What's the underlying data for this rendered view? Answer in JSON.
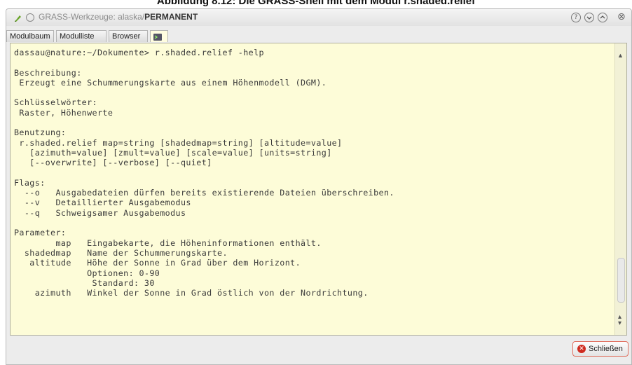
{
  "caption": {
    "text": "Abbildung 8.12: Die GRASS-Shell mit dem Modul r.shaded.relief"
  },
  "window": {
    "title_prefix": "GRASS-Werkzeuge: alaska/",
    "title_location": "PERMANENT",
    "controls": {
      "help_icon": "question-icon",
      "minimize_icon": "chevron-down-icon",
      "maximize_icon": "chevron-up-icon",
      "close_glyph": "⊗"
    }
  },
  "tabs": [
    {
      "label": "Modulbaum"
    },
    {
      "label": "Modulliste"
    },
    {
      "label": "Browser"
    },
    {
      "label": "",
      "icon": "shell-icon"
    }
  ],
  "console": {
    "lines": [
      "dassau@nature:~/Dokumente> r.shaded.relief -help",
      "",
      "Beschreibung:",
      " Erzeugt eine Schummerungskarte aus einem Höhenmodell (DGM).",
      "",
      "Schlüsselwörter:",
      " Raster, Höhenwerte",
      "",
      "Benutzung:",
      " r.shaded.relief map=string [shadedmap=string] [altitude=value]",
      "   [azimuth=value] [zmult=value] [scale=value] [units=string]",
      "   [--overwrite] [--verbose] [--quiet]",
      "",
      "Flags:",
      "  --o   Ausgabedateien dürfen bereits existierende Dateien überschreiben.",
      "  --v   Detaillierter Ausgabemodus",
      "  --q   Schweigsamer Ausgabemodus",
      "",
      "Parameter:",
      "        map   Eingabekarte, die Höheninformationen enthält.",
      "  shadedmap   Name der Schummerungskarte.",
      "   altitude   Höhe der Sonne in Grad über dem Horizont.",
      "              Optionen: 0-90",
      "               Standard: 30",
      "    azimuth   Winkel der Sonne in Grad östlich von der Nordrichtung."
    ]
  },
  "buttons": {
    "close_label": "Schließen"
  }
}
